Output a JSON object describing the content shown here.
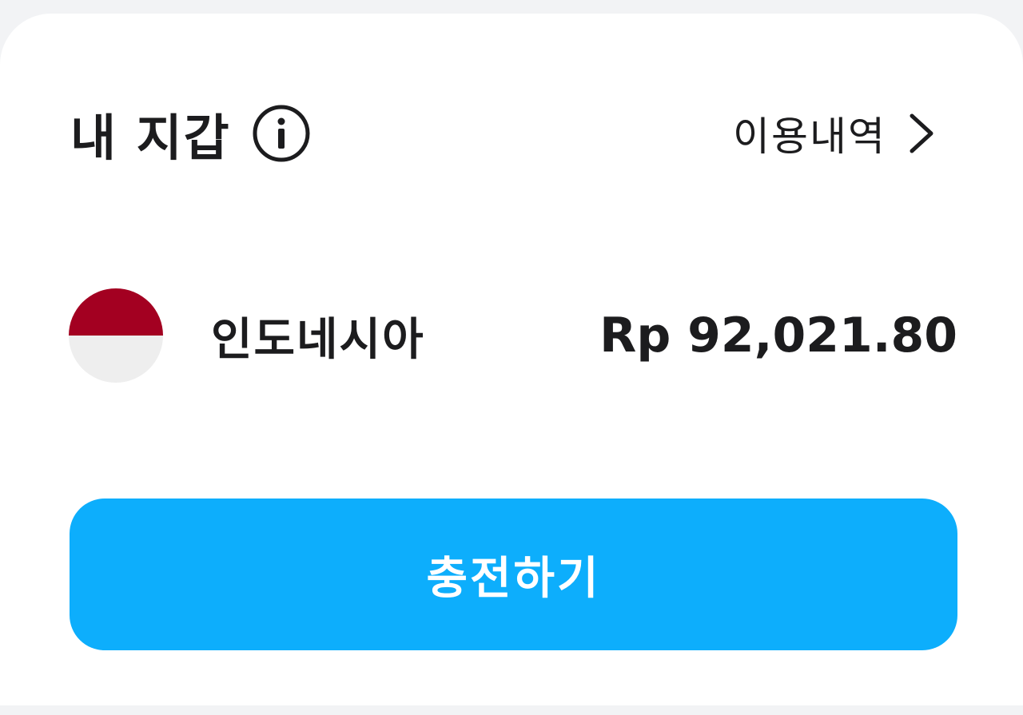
{
  "wallet": {
    "title": "내 지갑",
    "info_icon": "info-icon",
    "history_label": "이용내역",
    "history_icon": "chevron-right-icon"
  },
  "balances": [
    {
      "country": "인도네시아",
      "flag_icon": "indonesia-flag-icon",
      "flag_colors": [
        "#a30021",
        "#eeeeee"
      ],
      "amount": "Rp 92,021.80"
    }
  ],
  "actions": {
    "charge_label": "충전하기",
    "charge_color": "#0daefc"
  }
}
